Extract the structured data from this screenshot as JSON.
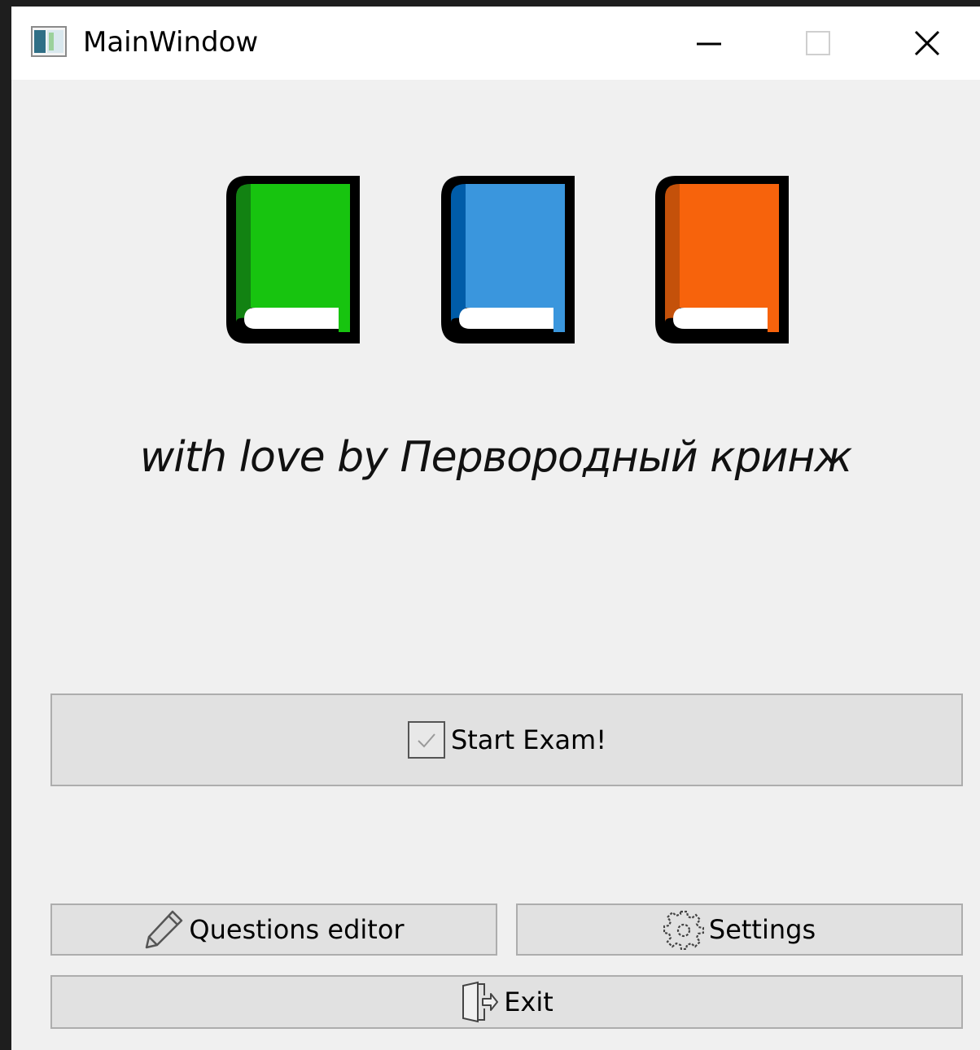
{
  "window": {
    "title": "MainWindow",
    "controls": [
      "minimize",
      "maximize",
      "close"
    ]
  },
  "banner": {
    "books": [
      {
        "color": "#17c40f",
        "spine": "#128212"
      },
      {
        "color": "#3a96dd",
        "spine": "#005ca8"
      },
      {
        "color": "#f7630c",
        "spine": "#c4510a"
      }
    ],
    "credit": "with love by Первородный кринж"
  },
  "buttons": {
    "start_exam": {
      "label": "Start Exam!",
      "icon": "checkbox-icon"
    },
    "questions_editor": {
      "label": "Questions editor",
      "icon": "pencil-icon"
    },
    "settings": {
      "label": "Settings",
      "icon": "gear-icon"
    },
    "exit": {
      "label": "Exit",
      "icon": "door-exit-icon"
    }
  }
}
